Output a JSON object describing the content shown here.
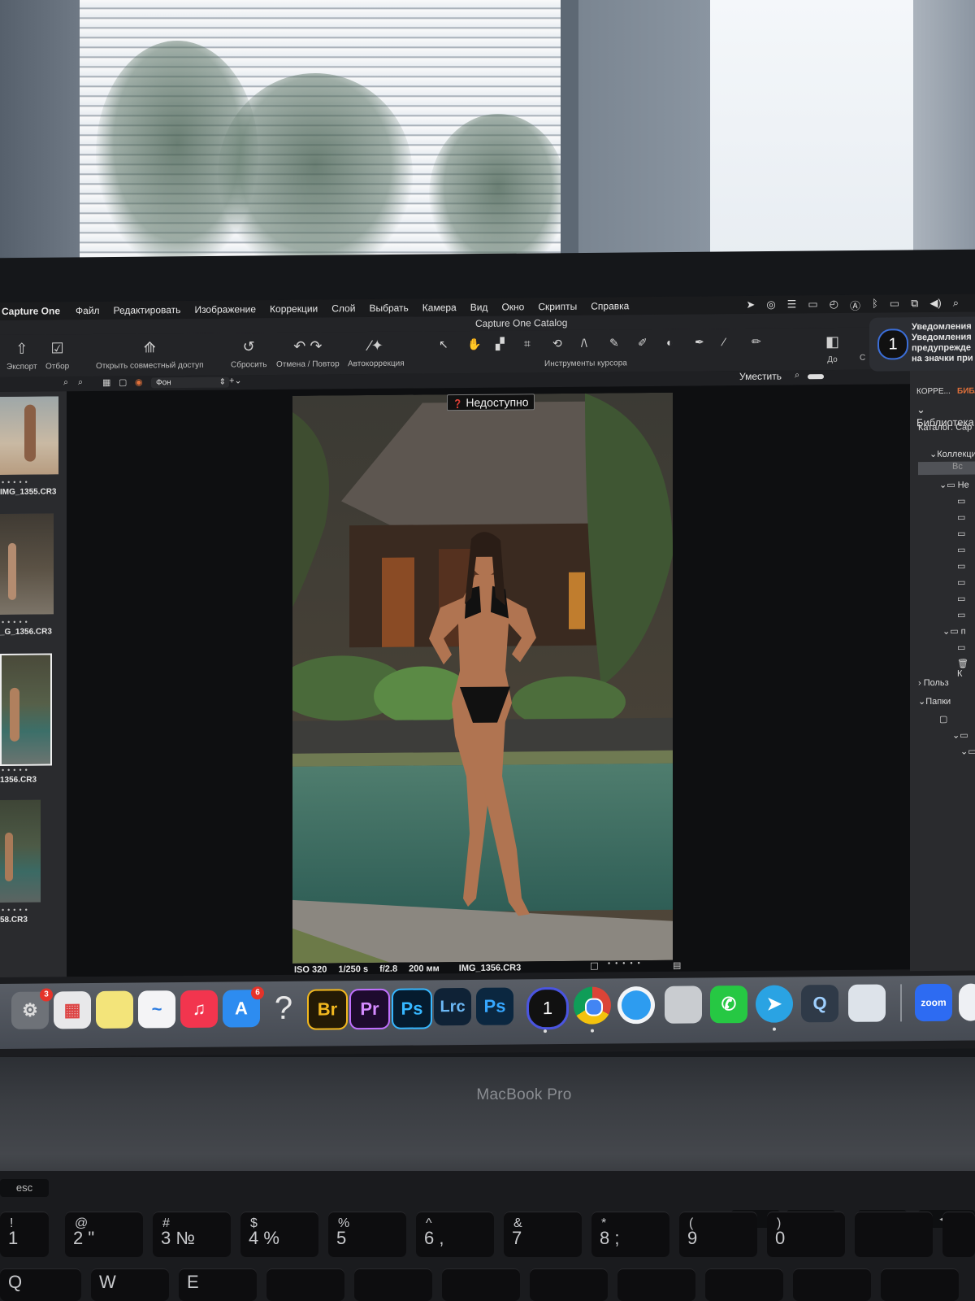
{
  "menubar": {
    "app_name": "Capture One",
    "items": [
      "Файл",
      "Редактировать",
      "Изображение",
      "Коррекции",
      "Слой",
      "Выбрать",
      "Камера",
      "Вид",
      "Окно",
      "Скрипты",
      "Справка"
    ]
  },
  "titlebar": {
    "title": "Capture One Catalog"
  },
  "toolbar": {
    "export": "Экспорт",
    "select": "Отбор",
    "share": "Открыть совместный доступ",
    "reset": "Сбросить",
    "undo_redo": "Отмена / Повтор",
    "auto": "Автокоррекция",
    "cursor_tools": "Инструменты курсора",
    "before": "До",
    "c": "С"
  },
  "subbar": {
    "background": "Фон",
    "fit": "Уместить"
  },
  "browser": {
    "thumbs": [
      {
        "label": "IMG_1355.CR3"
      },
      {
        "label": "_G_1356.CR3"
      },
      {
        "label": "1356.CR3"
      },
      {
        "label": "58.CR3"
      }
    ]
  },
  "viewer": {
    "unavailable": "Недоступно",
    "meta": {
      "iso": "ISO 320",
      "shutter": "1/250 s",
      "aperture": "f/2.8",
      "focal": "200 мм",
      "filename": "IMG_1356.CR3"
    }
  },
  "rpanel": {
    "tab1": "КОРРЕ...",
    "tab2": "БИБЛ",
    "library": "Библиотека",
    "catalog": "Каталог: Cap",
    "collections": "Коллекци",
    "all": "Вс",
    "ne": "Не",
    "p": "п",
    "k": "К",
    "user": "Польз",
    "folders": "Папки"
  },
  "notification": {
    "lines": [
      "Уведомления",
      "Уведомления",
      "предупрежде",
      "на значки при"
    ],
    "icon_number": "1"
  },
  "dock": {
    "items": [
      {
        "name": "system-settings",
        "label": "⚙",
        "badge": "3"
      },
      {
        "name": "launchpad",
        "label": "▦"
      },
      {
        "name": "notes",
        "label": ""
      },
      {
        "name": "freeform",
        "label": "~"
      },
      {
        "name": "music",
        "label": "♫"
      },
      {
        "name": "app-store",
        "label": "A",
        "badge": "6"
      },
      {
        "name": "help",
        "label": "?"
      },
      {
        "name": "bridge",
        "label": "Br"
      },
      {
        "name": "premiere",
        "label": "Pr"
      },
      {
        "name": "photoshop",
        "label": "Ps"
      },
      {
        "name": "lightroom-classic",
        "label": "Lrc"
      },
      {
        "name": "photoshop-2",
        "label": "Ps"
      },
      {
        "name": "capture-one",
        "label": "1"
      },
      {
        "name": "chrome",
        "label": ""
      },
      {
        "name": "safari",
        "label": ""
      },
      {
        "name": "photo-booth",
        "label": ""
      },
      {
        "name": "whatsapp",
        "label": "✆"
      },
      {
        "name": "telegram",
        "label": "➤"
      },
      {
        "name": "quicktime",
        "label": "Q"
      },
      {
        "name": "preview",
        "label": ""
      },
      {
        "name": "zoom",
        "label": "zoom"
      }
    ]
  },
  "hardware": {
    "brand": "MacBook Pro"
  },
  "keyboard": {
    "esc": "esc",
    "keys": [
      {
        "top": "!",
        "bottom": "1"
      },
      {
        "top": "@",
        "bottom": "2 \""
      },
      {
        "top": "#",
        "bottom": "3 №"
      },
      {
        "top": "$",
        "bottom": "4 %"
      },
      {
        "top": "%",
        "bottom": "5"
      },
      {
        "top": "^",
        "bottom": "6 ,"
      },
      {
        "top": "&",
        "bottom": "7"
      },
      {
        "top": "*",
        "bottom": "8 ;"
      },
      {
        "top": "(",
        "bottom": "9"
      },
      {
        "top": ")",
        "bottom": "0"
      }
    ],
    "row2": [
      "Q",
      "W",
      "E"
    ]
  }
}
